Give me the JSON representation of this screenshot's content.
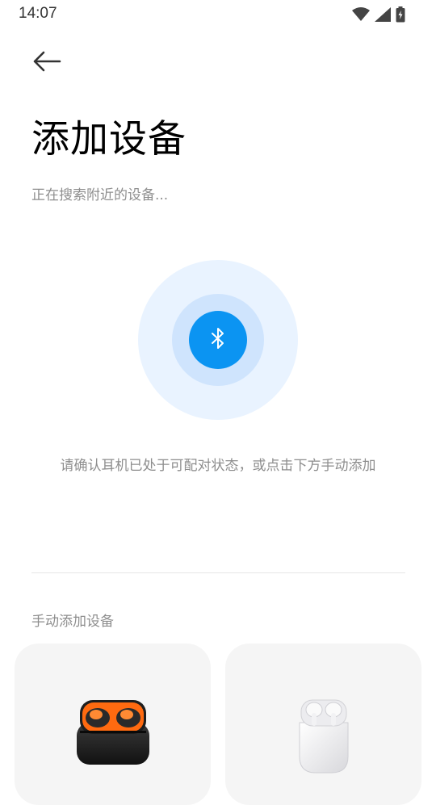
{
  "status_bar": {
    "time": "14:07",
    "icons": [
      "wifi-icon",
      "signal-icon",
      "battery-charging-icon"
    ]
  },
  "header": {
    "back_icon": "arrow-left-icon",
    "title": "添加设备",
    "subtitle": "正在搜索附近的设备..."
  },
  "scan": {
    "icon": "bluetooth-icon",
    "accent": "#0b94f2",
    "hint": "请确认耳机已处于可配对状态，或点击下方手动添加"
  },
  "manual": {
    "title": "手动添加设备",
    "devices": [
      {
        "image": "earbuds-case-orange-black"
      },
      {
        "image": "earbuds-case-white"
      }
    ]
  }
}
